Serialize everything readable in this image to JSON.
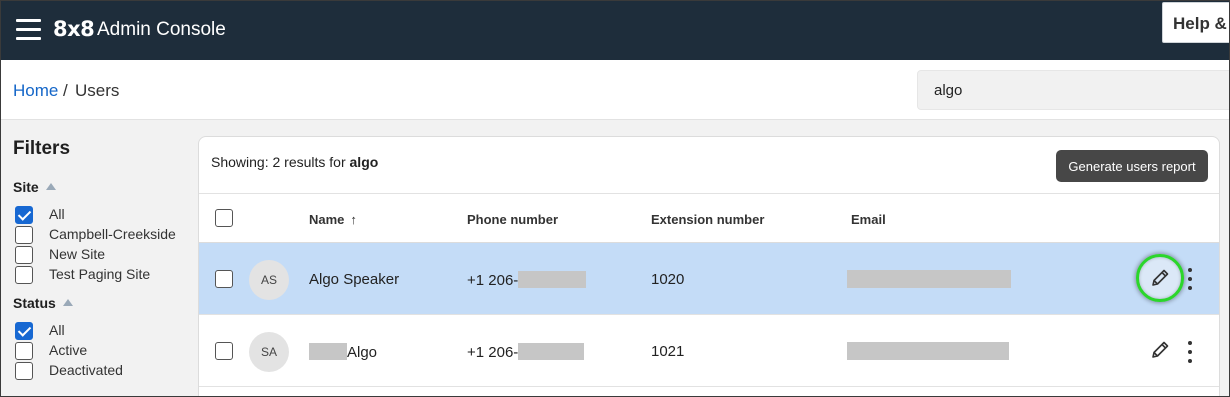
{
  "header": {
    "logo": "8x8",
    "app_title": "Admin Console",
    "help_label": "Help &"
  },
  "breadcrumb": {
    "home": "Home",
    "separator": "/",
    "current": "Users"
  },
  "search": {
    "value": "algo"
  },
  "filters": {
    "title": "Filters",
    "groups": [
      {
        "heading": "Site",
        "options": [
          {
            "label": "All",
            "checked": true
          },
          {
            "label": "Campbell-Creekside",
            "checked": false
          },
          {
            "label": "New Site",
            "checked": false
          },
          {
            "label": "Test Paging Site",
            "checked": false
          }
        ]
      },
      {
        "heading": "Status",
        "options": [
          {
            "label": "All",
            "checked": true
          },
          {
            "label": "Active",
            "checked": false
          },
          {
            "label": "Deactivated",
            "checked": false
          }
        ]
      }
    ]
  },
  "results": {
    "showing_prefix": "Showing: 2 results for",
    "query": "algo",
    "report_button": "Generate users report"
  },
  "table": {
    "columns": [
      "Name",
      "Phone number",
      "Extension number",
      "Email"
    ],
    "sort_icon": "arrow-up-icon",
    "rows": [
      {
        "initials": "AS",
        "name": "Algo Speaker",
        "phone_prefix": "+1 206-",
        "extension": "1020",
        "selected": true
      },
      {
        "initials": "SA",
        "name": "Algo",
        "phone_prefix": "+1 206-",
        "extension": "1021",
        "selected": false
      }
    ]
  },
  "icons": {
    "menu": "hamburger-menu-icon",
    "edit": "pencil-icon",
    "more": "more-vertical-icon"
  },
  "colors": {
    "topbar": "#1e2d3b",
    "link": "#1466c8",
    "checkbox_checked": "#1768d2",
    "row_selected": "#c4dcf7",
    "highlight_ring": "#2bd62b"
  }
}
